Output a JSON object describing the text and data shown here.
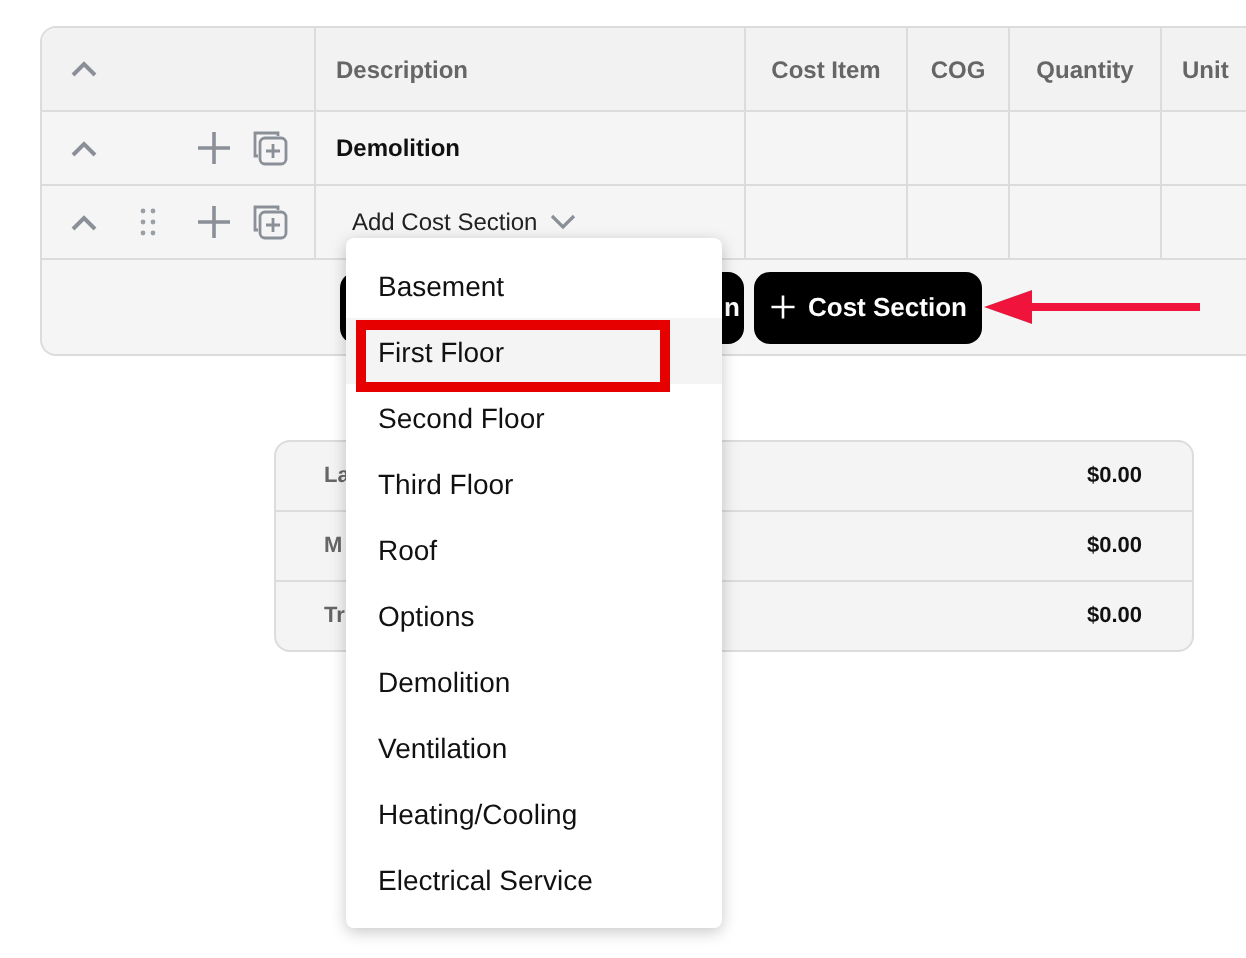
{
  "table": {
    "columns": [
      "Description",
      "Cost Item",
      "COG",
      "Quantity",
      "Unit"
    ],
    "rows": [
      {
        "kind": "section",
        "description": "Demolition",
        "draggable": false
      },
      {
        "kind": "add",
        "description": "Add Cost Section",
        "draggable": true
      }
    ],
    "footer_buttons": [
      {
        "kind": "plain",
        "label": "n"
      },
      {
        "kind": "add",
        "label": "Cost Section"
      }
    ]
  },
  "dropdown": {
    "items": [
      {
        "label": "Basement",
        "selected": false
      },
      {
        "label": "First Floor",
        "selected": true
      },
      {
        "label": "Second Floor",
        "selected": false
      },
      {
        "label": "Third Floor",
        "selected": false
      },
      {
        "label": "Roof",
        "selected": false
      },
      {
        "label": "Options",
        "selected": false
      },
      {
        "label": "Demolition",
        "selected": false
      },
      {
        "label": "Ventilation",
        "selected": false
      },
      {
        "label": "Heating/Cooling",
        "selected": false
      },
      {
        "label": "Electrical Service",
        "selected": false
      }
    ]
  },
  "summary": {
    "rows": [
      {
        "label": "La",
        "value": "$0.00"
      },
      {
        "label": "M",
        "value": "$0.00"
      },
      {
        "label": "Tr",
        "value": "$0.00"
      }
    ]
  }
}
